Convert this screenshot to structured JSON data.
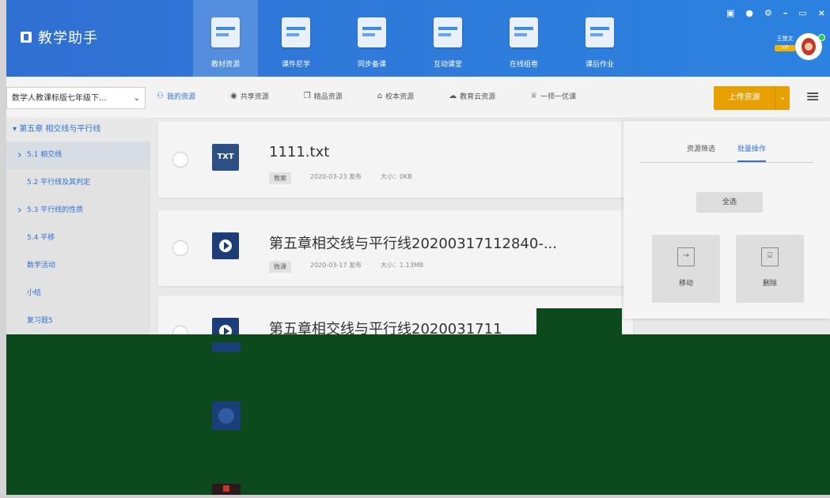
{
  "app": {
    "title": "教学助手"
  },
  "nav": {
    "items": [
      {
        "label": "教材资源",
        "active": true
      },
      {
        "label": "课件尼学",
        "active": false
      },
      {
        "label": "同步备课",
        "active": false
      },
      {
        "label": "互动课堂",
        "active": false
      },
      {
        "label": "在线组卷",
        "active": false
      },
      {
        "label": "课后作业",
        "active": false
      }
    ]
  },
  "window_controls": {
    "snap": "▣",
    "pin": "●",
    "settings": "⚙",
    "min": "–",
    "max": "▭",
    "close": "×"
  },
  "user": {
    "name": "王慧文",
    "badge": "VIP"
  },
  "toolbar": {
    "grade_select": "数学人教课标版七年级下...",
    "tabs": [
      {
        "label": "我的资源",
        "active": true
      },
      {
        "label": "共享资源",
        "active": false
      },
      {
        "label": "精品资源",
        "active": false
      },
      {
        "label": "校本资源",
        "active": false
      },
      {
        "label": "教育云资源",
        "active": false
      },
      {
        "label": "一师一优课",
        "active": false
      }
    ],
    "upload_label": "上传资源",
    "upload_arrow": "⌄",
    "menu_icon": "≡"
  },
  "sidebar": {
    "chapter": "第五章 相交线与平行线",
    "items": [
      {
        "label": "5.1 相交线",
        "arrow": true
      },
      {
        "label": "5.2 平行线及其判定",
        "arrow": false
      },
      {
        "label": "5.3 平行线的性质",
        "arrow": true
      },
      {
        "label": "5.4 平移",
        "arrow": false
      },
      {
        "label": "数学活动",
        "arrow": false
      },
      {
        "label": "小结",
        "arrow": false
      },
      {
        "label": "复习题5",
        "arrow": false
      }
    ]
  },
  "files": [
    {
      "icon": "TXT",
      "title": "1111.txt",
      "tag": "教案",
      "date": "2020-03-23 发布",
      "size": "大小：0KB"
    },
    {
      "icon": "video",
      "title": "第五章相交线与平行线20200317112840-...",
      "tag": "微课",
      "date": "2020-03-17 发布",
      "size": "大小：1.13MB"
    },
    {
      "icon": "video",
      "title": "第五章相交线与平行线2020031711",
      "tag": "",
      "date": "",
      "size": ""
    }
  ],
  "panel": {
    "tabs": [
      {
        "label": "资源筛选",
        "active": false
      },
      {
        "label": "批量操作",
        "active": true
      }
    ],
    "select_all": "全选",
    "move_label": "移动",
    "delete_label": "删除"
  },
  "colors": {
    "accent": "#2f72d4",
    "upload": "#e8a000",
    "overlay": "#0c4a1d"
  }
}
